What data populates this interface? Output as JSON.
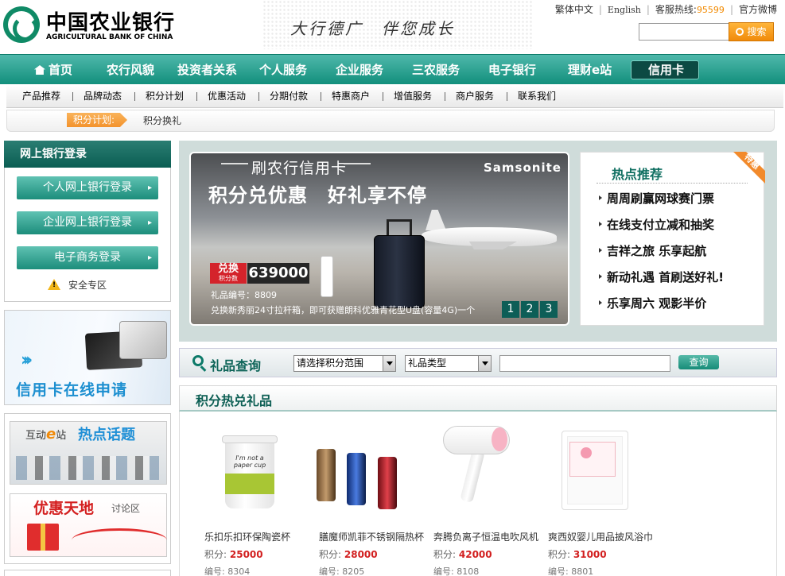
{
  "header": {
    "bank_name_cn": "中国农业银行",
    "bank_name_en": "AGRICULTURAL BANK OF CHINA",
    "slogan": "大行德广　伴您成长",
    "links": {
      "traditional": "繁体中文",
      "english": "English",
      "hotline_label": "客服热线:",
      "hotline_number": "95599",
      "weibo": "官方微博"
    },
    "search": {
      "placeholder": "",
      "button": "搜索"
    }
  },
  "nav": {
    "items": [
      "首页",
      "农行风貌",
      "投资者关系",
      "个人服务",
      "企业服务",
      "三农服务",
      "电子银行",
      "理财e站",
      "信用卡"
    ],
    "active": "信用卡"
  },
  "subnav": {
    "items": [
      "产品推荐",
      "品牌动态",
      "积分计划",
      "优惠活动",
      "分期付款",
      "特惠商户",
      "增值服务",
      "商户服务",
      "联系我们"
    ]
  },
  "breadcrumb": {
    "section": "积分计划:",
    "current": "积分换礼"
  },
  "sidebar": {
    "login_title": "网上银行登录",
    "login_buttons": [
      "个人网上银行登录",
      "企业网上银行登录",
      "电子商务登录"
    ],
    "safe_zone": "安全专区",
    "card_apply_banner": "信用卡在线申请",
    "topic_banner": {
      "prefix": "互动",
      "e": "e",
      "suffix": "站",
      "title": "热点话题"
    },
    "discount_banner": {
      "title": "优惠天地",
      "sub": "讨论区"
    }
  },
  "carousel": {
    "subtitle": "刷农行信用卡",
    "title": "积分兑优惠　好礼享不停",
    "brand": "Samsonite",
    "badge_label": "兑换",
    "badge_sub": "积分数",
    "points": "639000",
    "gift_no": "礼品编号：8809",
    "gift_desc": "兑换新秀丽24寸拉杆箱，即可获赠朗科优雅青花型U盘(容量4G)一个",
    "pages": [
      "1",
      "2",
      "3"
    ],
    "active_page": "1"
  },
  "hot": {
    "title": "热点推荐",
    "ribbon": "特惠",
    "items": [
      "周周刷赢网球赛门票",
      "在线支付立减和抽奖",
      "吉祥之旅 乐享起航",
      "新动礼遇 首刷送好礼!",
      "乐享周六 观影半价"
    ]
  },
  "query": {
    "title": "礼品查询",
    "range_select": "请选择积分范围",
    "type_select": "礼品类型",
    "keyword_value": "",
    "button": "查询"
  },
  "gifts": {
    "title": "积分热兑礼品",
    "points_label": "积分:",
    "no_label": "编号:",
    "items": [
      {
        "name": "乐扣乐扣环保陶瓷杯",
        "points": "25000",
        "no": "8304",
        "image_text": "I'm not a paper cup"
      },
      {
        "name": "膳魔师凯菲不锈钢隔热杯",
        "points": "28000",
        "no": "8205"
      },
      {
        "name": "奔腾负离子恒温电吹风机",
        "points": "42000",
        "no": "8108"
      },
      {
        "name": "爽西奴婴儿用品披风浴巾",
        "points": "31000",
        "no": "8801"
      }
    ]
  },
  "colors": {
    "brand_green": "#128f7c",
    "accent_orange": "#f28a00",
    "price_red": "#d21f1f"
  }
}
